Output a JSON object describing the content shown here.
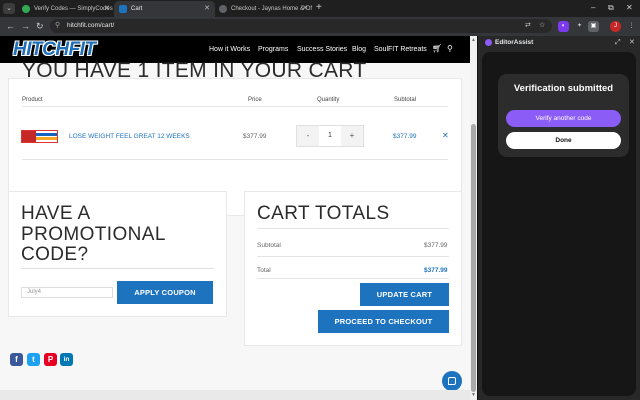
{
  "browser": {
    "tabs": [
      {
        "title": "Verify Codes — SimplyCodes",
        "active": false
      },
      {
        "title": "Cart",
        "active": true
      },
      {
        "title": "Checkout - Jaynas Home & Of",
        "active": false
      }
    ],
    "url": "hitchfit.com/cart/",
    "window_controls": {
      "minimize": "–",
      "maximize": "⧉",
      "close": "✕"
    }
  },
  "site": {
    "logo": "HITCHFIT",
    "nav": [
      "How it Works",
      "Programs",
      "Success Stories",
      "Blog",
      "SoulFIT Retreats"
    ]
  },
  "cart": {
    "heading": "YOU HAVE 1 ITEM IN YOUR CART",
    "columns": {
      "product": "Product",
      "price": "Price",
      "quantity": "Quantity",
      "subtotal": "Subtotal"
    },
    "items": [
      {
        "name": "LOSE WEIGHT FEEL GREAT 12 WEEKS",
        "price": "$377.99",
        "quantity": "1",
        "subtotal": "$377.99"
      }
    ],
    "qty_minus": "-",
    "qty_plus": "+",
    "remove": "✕"
  },
  "promo": {
    "title": "HAVE A PROMOTIONAL CODE?",
    "input_value": "July4",
    "apply_label": "APPLY COUPON"
  },
  "totals": {
    "title": "CART TOTALS",
    "subtotal_label": "Subtotal",
    "subtotal_value": "$377.99",
    "total_label": "Total",
    "total_value": "$377.99",
    "update_label": "UPDATE CART",
    "checkout_label": "PROCEED TO CHECKOUT"
  },
  "share_buttons": [
    {
      "name": "facebook",
      "glyph": "f",
      "color": "#3b5998"
    },
    {
      "name": "twitter",
      "glyph": "t",
      "color": "#1da1f2"
    },
    {
      "name": "pinterest",
      "glyph": "P",
      "color": "#e60023"
    },
    {
      "name": "linkedin",
      "glyph": "in",
      "color": "#0077b5"
    }
  ],
  "side_panel": {
    "title": "EditorAssist",
    "card_title": "Verification submitted",
    "verify_another_label": "Verify another code",
    "done_label": "Done"
  },
  "colors": {
    "brand_blue": "#1e73be",
    "panel_accent": "#8b5cf6"
  }
}
